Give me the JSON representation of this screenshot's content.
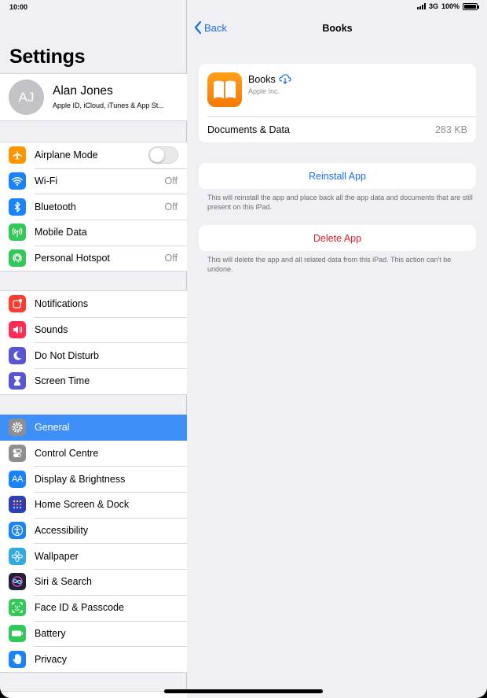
{
  "status": {
    "time": "10:00",
    "network": "3G",
    "battery": "100%",
    "battery_level": 1.0
  },
  "sidebar": {
    "title": "Settings",
    "profile": {
      "initials": "AJ",
      "name": "Alan Jones",
      "subtitle": "Apple ID, iCloud, iTunes & App St..."
    },
    "groups": [
      [
        {
          "label": "Airplane Mode",
          "icon": "airplane-icon",
          "color": "#ff9500",
          "toggle": false
        },
        {
          "label": "Wi-Fi",
          "value": "Off",
          "icon": "wifi-icon",
          "color": "#1a82fb"
        },
        {
          "label": "Bluetooth",
          "value": "Off",
          "icon": "bluetooth-icon",
          "color": "#1a82fb"
        },
        {
          "label": "Mobile Data",
          "icon": "antenna-icon",
          "color": "#34c759"
        },
        {
          "label": "Personal Hotspot",
          "value": "Off",
          "icon": "hotspot-icon",
          "color": "#34c759"
        }
      ],
      [
        {
          "label": "Notifications",
          "icon": "notifications-icon",
          "color": "#ff3b30"
        },
        {
          "label": "Sounds",
          "icon": "speaker-icon",
          "color": "#ff2d55"
        },
        {
          "label": "Do Not Disturb",
          "icon": "moon-icon",
          "color": "#5856d6"
        },
        {
          "label": "Screen Time",
          "icon": "hourglass-icon",
          "color": "#5856d6"
        }
      ],
      [
        {
          "label": "General",
          "icon": "gear-icon",
          "color": "#8e8e93",
          "selected": true
        },
        {
          "label": "Control Centre",
          "icon": "switches-icon",
          "color": "#8e8e93"
        },
        {
          "label": "Display & Brightness",
          "icon": "text-size-icon",
          "color": "#1a82fb"
        },
        {
          "label": "Home Screen & Dock",
          "icon": "app-grid-icon",
          "color": "#2f3fb3"
        },
        {
          "label": "Accessibility",
          "icon": "accessibility-icon",
          "color": "#1a82fb"
        },
        {
          "label": "Wallpaper",
          "icon": "flower-icon",
          "color": "#35aadc"
        },
        {
          "label": "Siri & Search",
          "icon": "siri-icon",
          "color": "#222233"
        },
        {
          "label": "Face ID & Passcode",
          "icon": "face-id-icon",
          "color": "#34c759"
        },
        {
          "label": "Battery",
          "icon": "battery-icon",
          "color": "#34c759"
        },
        {
          "label": "Privacy",
          "icon": "hand-icon",
          "color": "#1a82fb"
        }
      ]
    ]
  },
  "detail": {
    "back_label": "Back",
    "title": "Books",
    "app": {
      "name": "Books",
      "vendor": "Apple Inc."
    },
    "documents_label": "Documents & Data",
    "documents_size": "283 KB",
    "reinstall_label": "Reinstall App",
    "reinstall_note": "This will reinstall the app and place back all the app data and documents that are still present on this iPad.",
    "delete_label": "Delete App",
    "delete_note": "This will delete the app and all related data from this iPad. This action can't be undone."
  }
}
